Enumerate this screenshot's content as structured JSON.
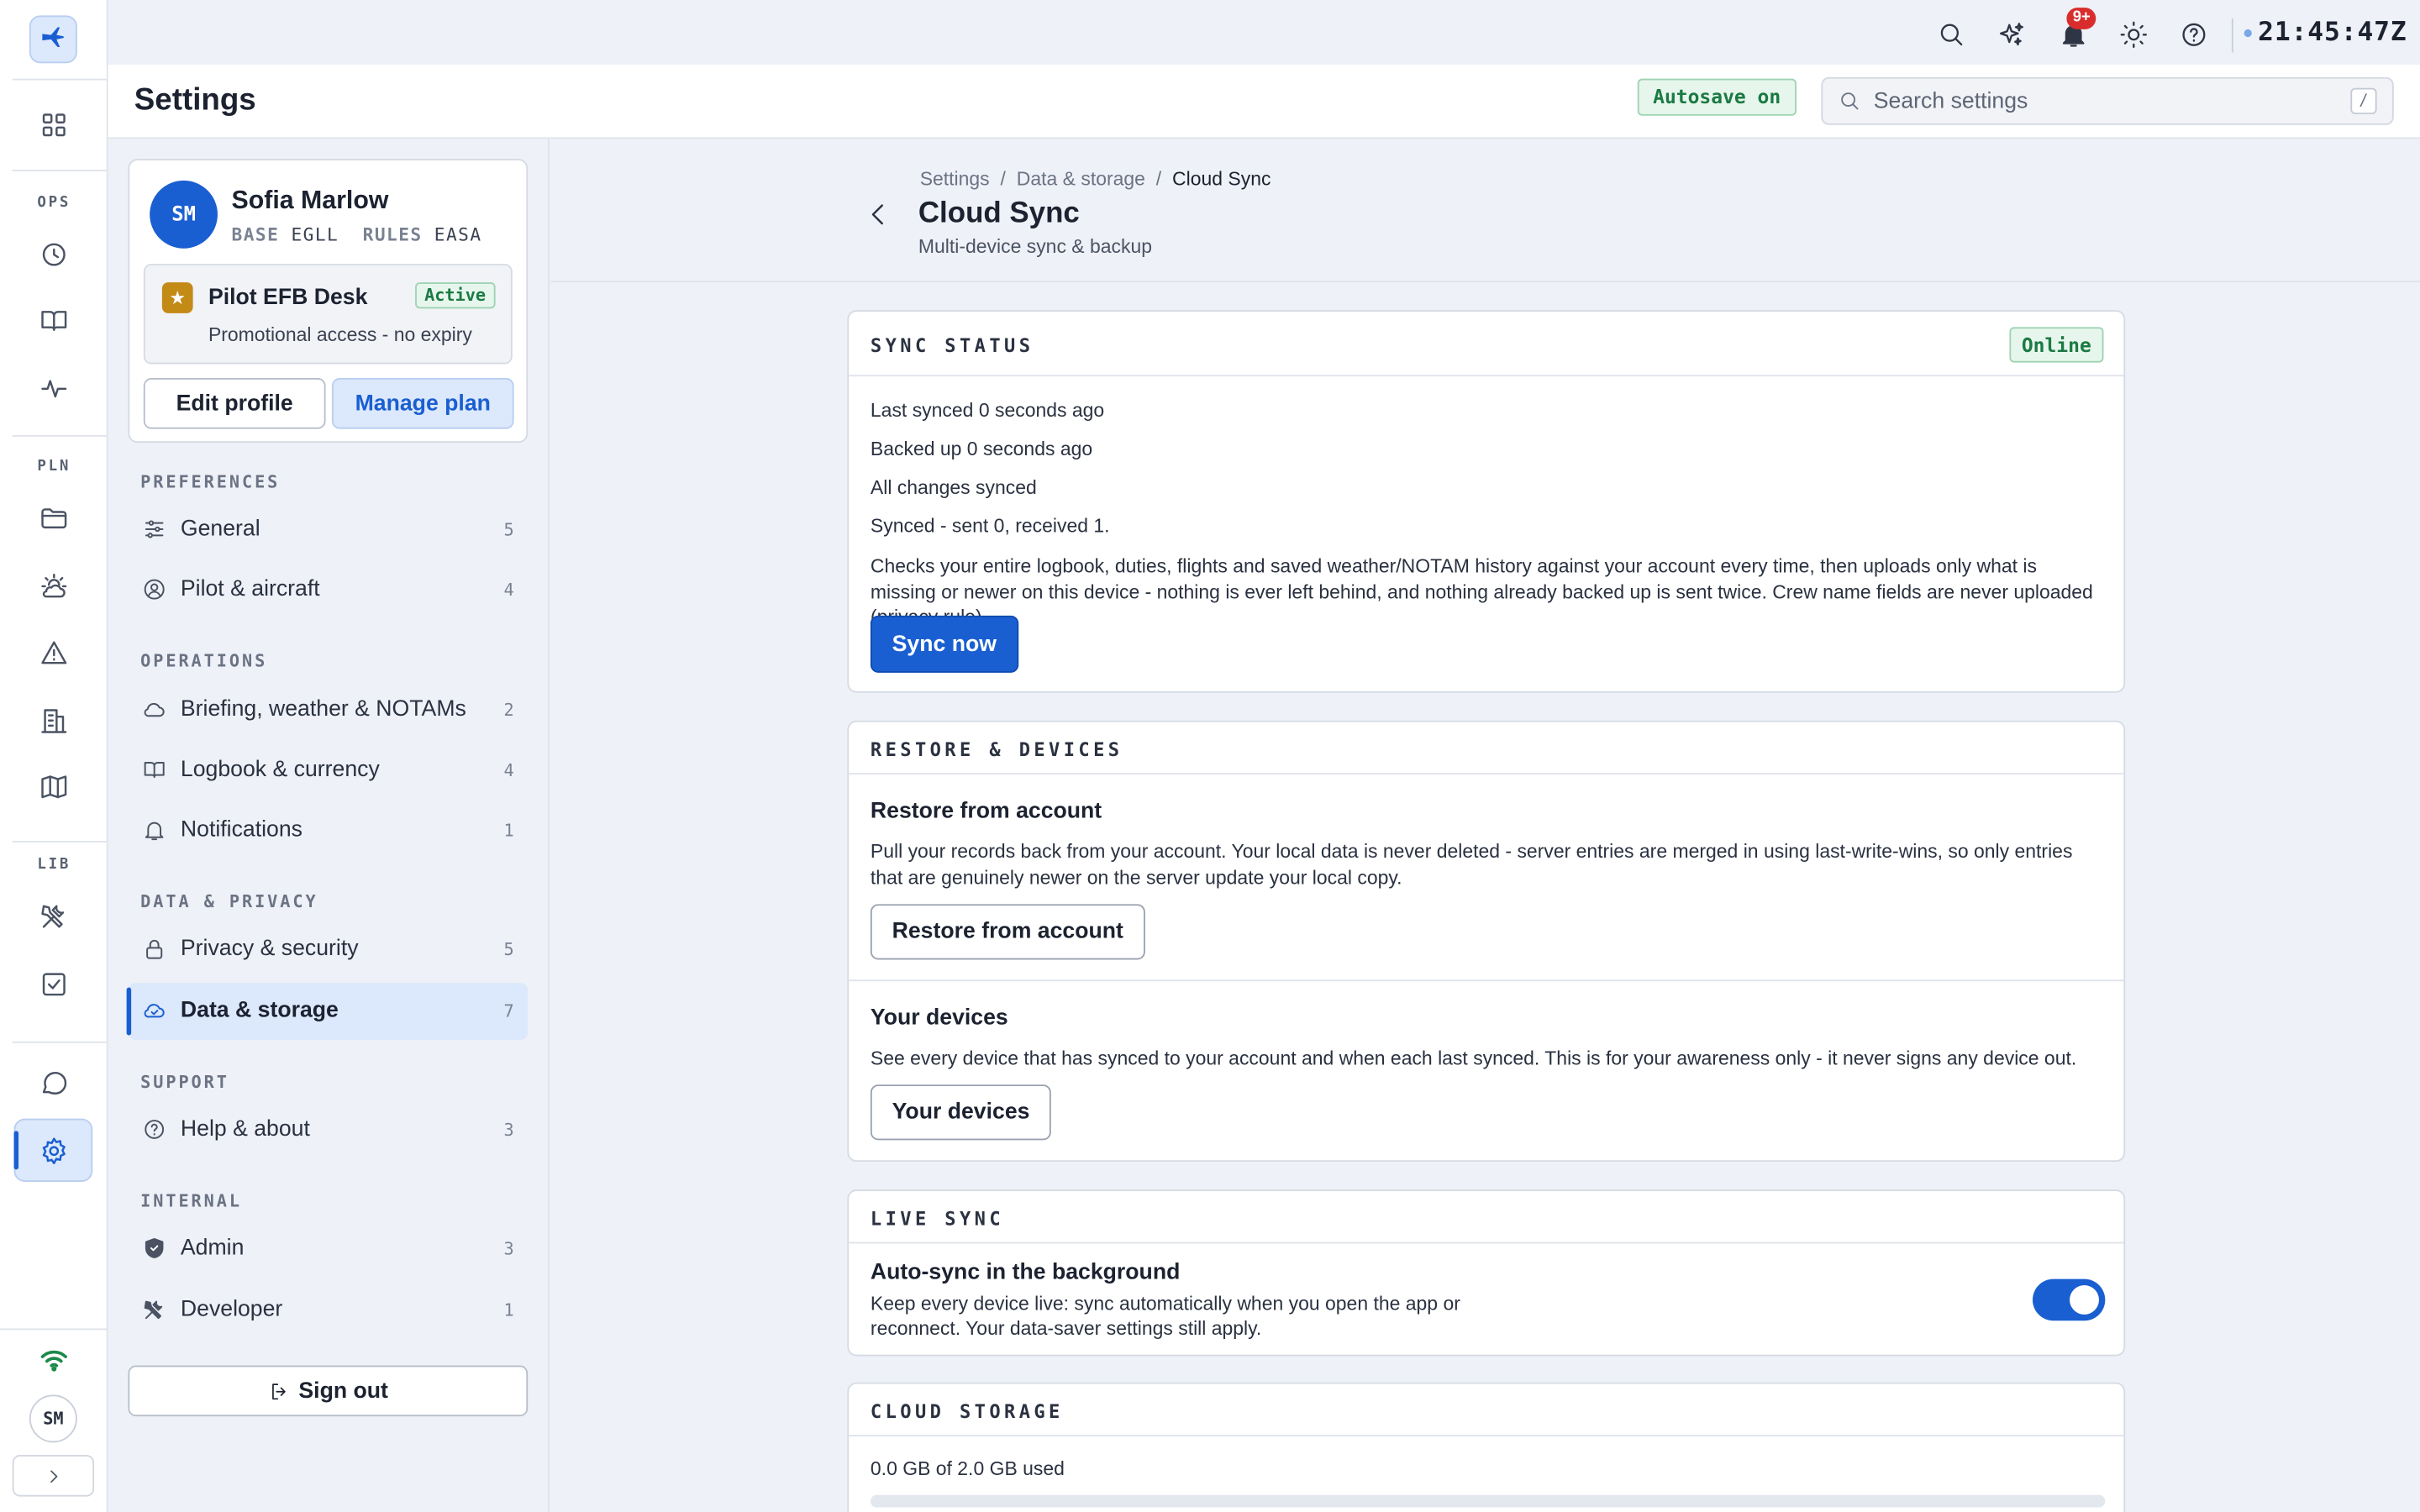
{
  "topbar": {
    "time": "21:45:47Z",
    "notification_count": "9+"
  },
  "rail": {
    "sections": [
      "OPS",
      "PLN",
      "LIB"
    ],
    "avatar_initials": "SM"
  },
  "header": {
    "title": "Settings",
    "autosave": "Autosave on",
    "search_placeholder": "Search settings",
    "search_shortcut": "/"
  },
  "profile": {
    "initials": "SM",
    "name": "Sofia Marlow",
    "base_label": "BASE",
    "base": "EGLL",
    "rules_label": "RULES",
    "rules": "EASA",
    "plan_name": "Pilot EFB Desk",
    "plan_status": "Active",
    "plan_desc": "Promotional access - no expiry",
    "edit_label": "Edit profile",
    "manage_label": "Manage plan"
  },
  "nav": {
    "sections": [
      "PREFERENCES",
      "OPERATIONS",
      "DATA & PRIVACY",
      "SUPPORT",
      "INTERNAL"
    ],
    "items": [
      {
        "label": "General",
        "count": "5"
      },
      {
        "label": "Pilot & aircraft",
        "count": "4"
      },
      {
        "label": "Briefing, weather & NOTAMs",
        "count": "2"
      },
      {
        "label": "Logbook & currency",
        "count": "4"
      },
      {
        "label": "Notifications",
        "count": "1"
      },
      {
        "label": "Privacy & security",
        "count": "5"
      },
      {
        "label": "Data & storage",
        "count": "7"
      },
      {
        "label": "Help & about",
        "count": "3"
      },
      {
        "label": "Admin",
        "count": "3"
      },
      {
        "label": "Developer",
        "count": "1"
      }
    ],
    "signout_label": "Sign out"
  },
  "page": {
    "breadcrumb": [
      "Settings",
      "/",
      "Data & storage",
      "/",
      "Cloud Sync"
    ],
    "title": "Cloud Sync",
    "subtitle": "Multi-device sync & backup"
  },
  "sync_status": {
    "title": "SYNC STATUS",
    "status": "Online",
    "last_synced": "Last synced 0 seconds ago",
    "backed_up": "Backed up 0 seconds ago",
    "all_synced": "All changes synced",
    "counts": "Synced - sent 0, received 1.",
    "description": "Checks your entire logbook, duties, flights and saved weather/NOTAM history against your account every time, then uploads only what is missing or newer on this device - nothing is ever left behind, and nothing already backed up is sent twice. Crew name fields are never uploaded (privacy rule).",
    "button": "Sync now"
  },
  "restore": {
    "title": "RESTORE & DEVICES",
    "restore_heading": "Restore from account",
    "restore_desc": "Pull your records back from your account. Your local data is never deleted - server entries are merged in using last-write-wins, so only entries that are genuinely newer on the server update your local copy.",
    "restore_button": "Restore from account",
    "devices_heading": "Your devices",
    "devices_desc": "See every device that has synced to your account and when each last synced. This is for your awareness only - it never signs any device out.",
    "devices_button": "Your devices"
  },
  "live_sync": {
    "title": "LIVE SYNC",
    "heading": "Auto-sync in the background",
    "desc_1": "Keep every device live: sync automatically when you open the app or",
    "desc_2": "reconnect. Your data-saver settings still apply.",
    "enabled": true
  },
  "storage": {
    "title": "CLOUD STORAGE",
    "usage": "0.0 GB of 2.0 GB used",
    "used_fraction": 0.0
  },
  "colors": {
    "accent": "#1a5fd1",
    "success": "#1b7a43",
    "alert": "#d92d2d"
  }
}
